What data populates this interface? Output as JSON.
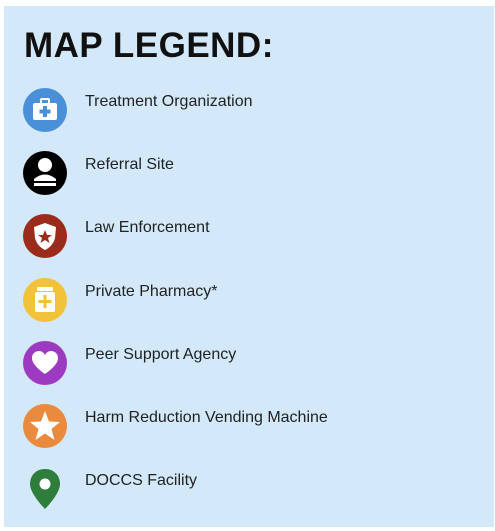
{
  "legend": {
    "title": "MAP LEGEND:",
    "items": [
      {
        "label": "Treatment Organization",
        "icon": "medical-kit-icon",
        "color": "#4a90d9"
      },
      {
        "label": "Referral Site",
        "icon": "person-icon",
        "color": "#000000"
      },
      {
        "label": "Law Enforcement",
        "icon": "police-badge-icon",
        "color": "#9b2c1c"
      },
      {
        "label": "Private Pharmacy*",
        "icon": "pharmacy-icon",
        "color": "#f2c23a"
      },
      {
        "label": "Peer Support Agency",
        "icon": "heart-icon",
        "color": "#9c3ac2"
      },
      {
        "label": "Harm Reduction Vending Machine",
        "icon": "star-icon",
        "color": "#ea8a3e"
      },
      {
        "label": "DOCCS Facility",
        "icon": "map-pin-icon",
        "color": "#2e7d3a"
      }
    ]
  }
}
